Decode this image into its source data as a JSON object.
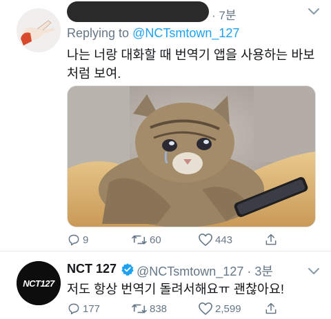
{
  "reply_tweet": {
    "time": "· 7분",
    "replying_label": "Replying to",
    "replying_handle": "@NCTsmtown_127",
    "text": "나는 너랑 대화할 때 번역기 앱을 사용하는 바보처럼 보여.",
    "media_icon": "crying-cat-holding-phone",
    "stats": {
      "replies": "9",
      "retweets": "60",
      "likes": "443"
    }
  },
  "original_tweet": {
    "name": "NCT 127",
    "handle_time": "@NCTsmtown_127 · 3분",
    "text": "저도 항상 번역기 돌려서해요ㅠ 괜찮아요!",
    "avatar_logo": "NCT127",
    "stats": {
      "replies": "177",
      "retweets": "838",
      "likes": "2,599"
    }
  },
  "colors": {
    "secondary": "#657786",
    "link": "#1da1f2",
    "verified": "#1da1f2"
  }
}
